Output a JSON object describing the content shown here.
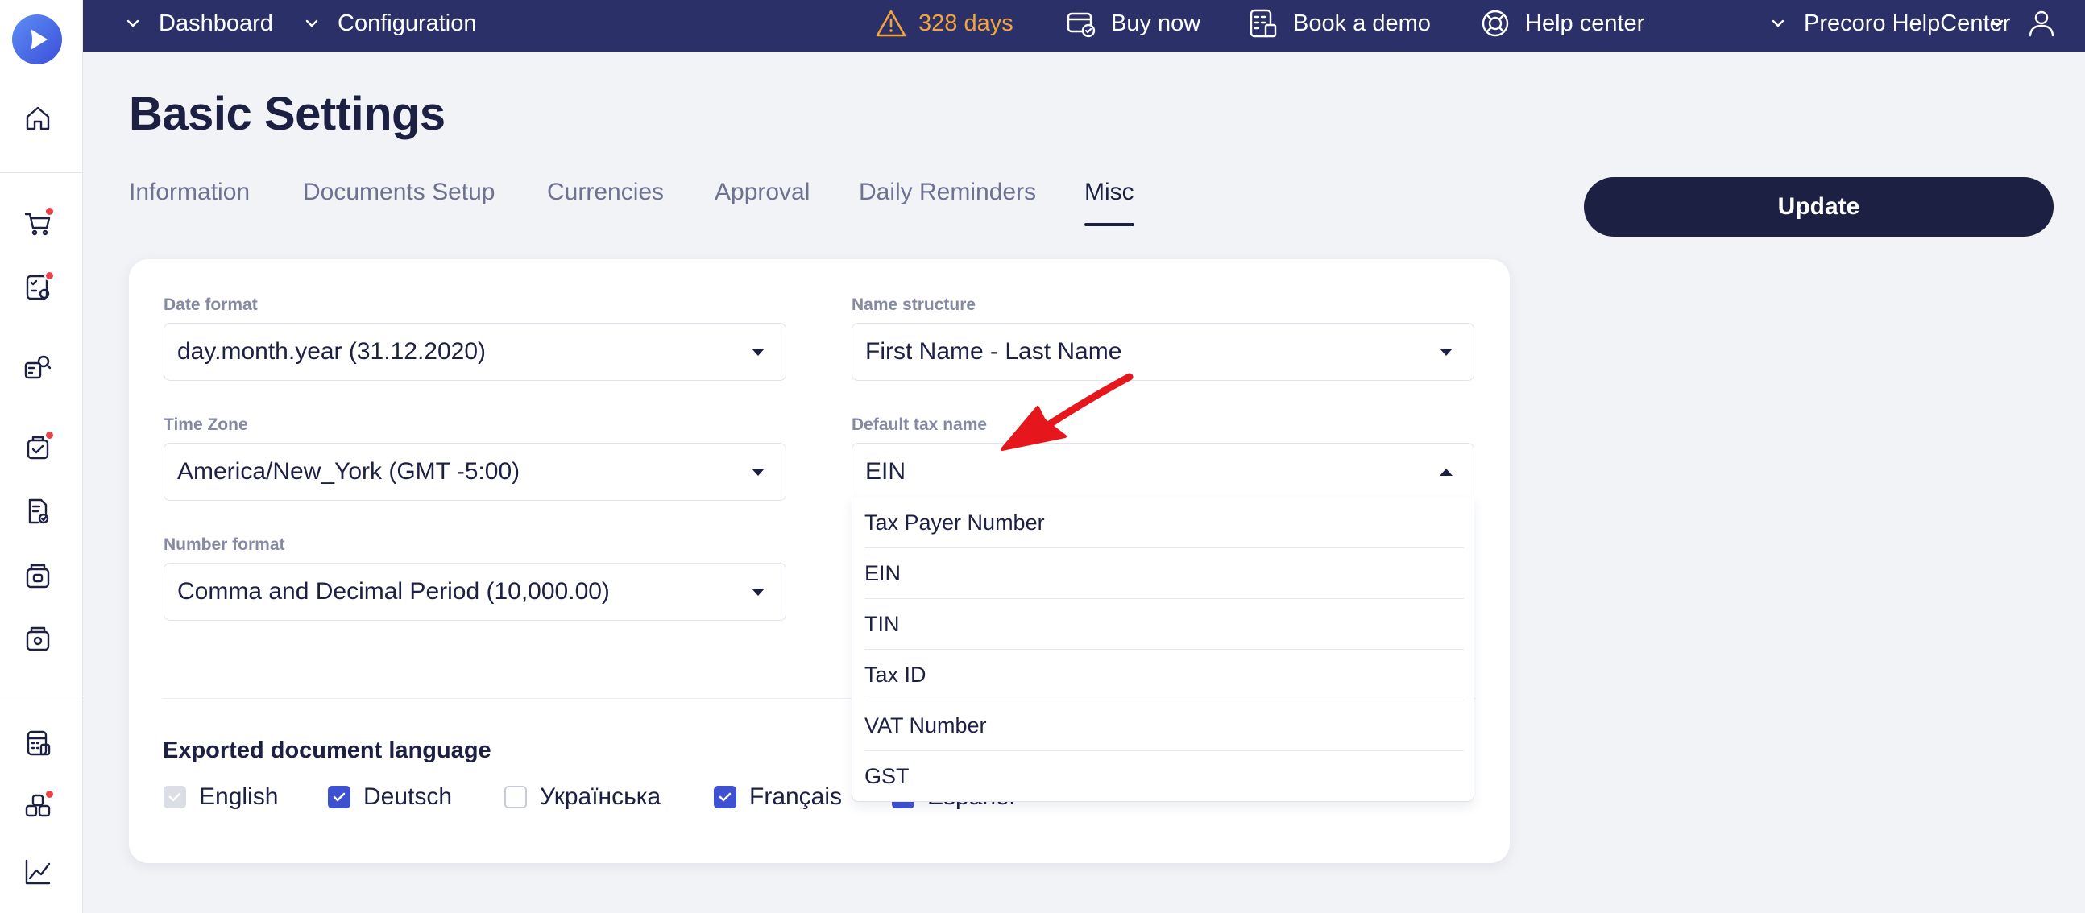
{
  "topbar": {
    "nav": [
      {
        "label": "Dashboard"
      },
      {
        "label": "Configuration"
      }
    ],
    "trial_days": "328 days",
    "buy_now": "Buy now",
    "book_demo": "Book a demo",
    "help_center": "Help center",
    "company": "Precoro HelpCenter"
  },
  "page": {
    "title": "Basic Settings"
  },
  "tabs": [
    {
      "label": "Information"
    },
    {
      "label": "Documents Setup"
    },
    {
      "label": "Currencies"
    },
    {
      "label": "Approval"
    },
    {
      "label": "Daily Reminders"
    },
    {
      "label": "Misc"
    }
  ],
  "actions": {
    "update": "Update"
  },
  "form": {
    "date_format": {
      "label": "Date format",
      "value": "day.month.year (31.12.2020)"
    },
    "name_structure": {
      "label": "Name structure",
      "value": "First Name - Last Name"
    },
    "time_zone": {
      "label": "Time Zone",
      "value": "America/New_York (GMT -5:00)"
    },
    "default_tax_name": {
      "label": "Default tax name",
      "value": "EIN",
      "options": [
        "Tax Payer Number",
        "EIN",
        "TIN",
        "Tax ID",
        "VAT Number",
        "GST"
      ]
    },
    "number_format": {
      "label": "Number format",
      "value": "Comma and Decimal Period (10,000.00)"
    }
  },
  "export_language": {
    "title": "Exported document language",
    "languages": [
      {
        "label": "English",
        "checked": true,
        "disabled": true
      },
      {
        "label": "Deutsch",
        "checked": true
      },
      {
        "label": "Українська",
        "checked": false
      },
      {
        "label": "Français",
        "checked": true
      },
      {
        "label": "Español",
        "checked": true
      }
    ]
  },
  "colors": {
    "topbar": "#2b3068",
    "primary": "#1c2042",
    "accent": "#3e51d1",
    "warning": "#f2a33a",
    "badge": "#e8424a",
    "annotation_arrow": "#e5161c"
  }
}
